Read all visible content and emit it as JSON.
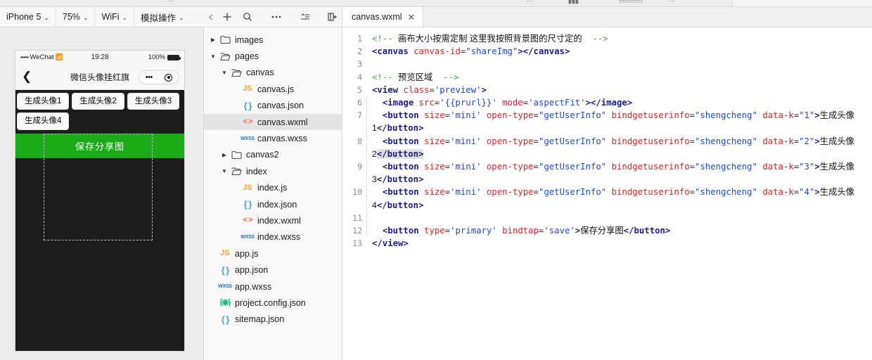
{
  "top_bar": {
    "ghosts": [
      "···",
      "···",
      "▮▮▮",
      "▭▭▭▭",
      "···"
    ]
  },
  "simulator": {
    "toolbar": [
      {
        "label": "iPhone 5",
        "caret": "⌄",
        "name": "device-selector"
      },
      {
        "label": "75%",
        "caret": "⌄",
        "name": "zoom-selector"
      },
      {
        "label": "WiFi",
        "caret": "⌄",
        "name": "network-selector"
      },
      {
        "label": "模拟操作",
        "caret": "⌄",
        "name": "simulate-action-selector"
      }
    ],
    "phone": {
      "status": {
        "signal_dots": "•••••",
        "carrier": "WeChat",
        "wifi_icon": "wifi-icon",
        "time": "19:28",
        "battery_percent": "100%"
      },
      "nav": {
        "back_icon": "back-chevron-icon",
        "title": "微信头像挂红旗",
        "capsule_dots": "•••",
        "capsule_target": "target-icon"
      },
      "mini_buttons": [
        "生成头像1",
        "生成头像2",
        "生成头像3",
        "生成头像4"
      ],
      "primary_button": "保存分享图",
      "canvas_placeholder": "canvas-placeholder"
    }
  },
  "explorer": {
    "toolbar_icons": [
      {
        "name": "back-arrow-icon",
        "glyph": "⤶"
      },
      {
        "name": "add-icon",
        "glyph": "+"
      },
      {
        "name": "search-icon",
        "glyph": "search"
      },
      {
        "name": "more-icon",
        "glyph": "•••"
      },
      {
        "name": "collapse-all-icon",
        "glyph": "collapse"
      },
      {
        "name": "toggle-panel-icon",
        "glyph": "panel"
      }
    ],
    "tree": [
      {
        "label": "images",
        "indent": 0,
        "twisty": "▶",
        "icon": "folder-closed",
        "selected": false
      },
      {
        "label": "pages",
        "indent": 0,
        "twisty": "▼",
        "icon": "folder-open",
        "selected": false
      },
      {
        "label": "canvas",
        "indent": 1,
        "twisty": "▼",
        "icon": "folder-open",
        "selected": false
      },
      {
        "label": "canvas.js",
        "indent": 2,
        "twisty": "",
        "icon": "js",
        "selected": false
      },
      {
        "label": "canvas.json",
        "indent": 2,
        "twisty": "",
        "icon": "json",
        "selected": false
      },
      {
        "label": "canvas.wxml",
        "indent": 2,
        "twisty": "",
        "icon": "wxml",
        "selected": true
      },
      {
        "label": "canvas.wxss",
        "indent": 2,
        "twisty": "",
        "icon": "wxss",
        "selected": false
      },
      {
        "label": "canvas2",
        "indent": 1,
        "twisty": "▶",
        "icon": "folder-closed",
        "selected": false
      },
      {
        "label": "index",
        "indent": 1,
        "twisty": "▼",
        "icon": "folder-open",
        "selected": false
      },
      {
        "label": "index.js",
        "indent": 2,
        "twisty": "",
        "icon": "js",
        "selected": false
      },
      {
        "label": "index.json",
        "indent": 2,
        "twisty": "",
        "icon": "json",
        "selected": false
      },
      {
        "label": "index.wxml",
        "indent": 2,
        "twisty": "",
        "icon": "wxml",
        "selected": false
      },
      {
        "label": "index.wxss",
        "indent": 2,
        "twisty": "",
        "icon": "wxss",
        "selected": false
      },
      {
        "label": "app.js",
        "indent": 0,
        "twisty": "",
        "icon": "js",
        "selected": false
      },
      {
        "label": "app.json",
        "indent": 0,
        "twisty": "",
        "icon": "json",
        "selected": false
      },
      {
        "label": "app.wxss",
        "indent": 0,
        "twisty": "",
        "icon": "wxss",
        "selected": false
      },
      {
        "label": "project.config.json",
        "indent": 0,
        "twisty": "",
        "icon": "cfg",
        "selected": false
      },
      {
        "label": "sitemap.json",
        "indent": 0,
        "twisty": "",
        "icon": "json",
        "selected": false
      }
    ]
  },
  "editor": {
    "tab": {
      "label": "canvas.wxml",
      "close": "✕"
    },
    "lines": [
      {
        "n": "1",
        "guide": false
      },
      {
        "n": "2",
        "guide": false
      },
      {
        "n": "3",
        "guide": false
      },
      {
        "n": "4",
        "guide": false
      },
      {
        "n": "5",
        "guide": false
      },
      {
        "n": "6",
        "guide": true
      },
      {
        "n": "7",
        "guide": true
      },
      {
        "n": "8",
        "guide": true
      },
      {
        "n": "9",
        "guide": true
      },
      {
        "n": "10",
        "guide": true
      },
      {
        "n": "11",
        "guide": true
      },
      {
        "n": "12",
        "guide": true
      },
      {
        "n": "13",
        "guide": false
      }
    ],
    "code_text": {
      "l1": "<!-- 画布大小按需定制 这里我按照背景图的尺寸定的  -->",
      "l2": "<canvas canvas-id=\"shareImg\"></canvas>",
      "l4": "<!-- 预览区域  -->",
      "l5": "<view class='preview'>",
      "l6": "<image src='{{prurl}}' mode='aspectFit'></image>",
      "l7": "<button size='mini' open-type=\"getUserInfo\" bindgetuserinfo=\"shengcheng\" data-k=\"1\">生成头像1</button>",
      "l8": "<button size='mini' open-type=\"getUserInfo\" bindgetuserinfo=\"shengcheng\" data-k=\"2\">生成头像2</button>",
      "l9": "<button size='mini' open-type=\"getUserInfo\" bindgetuserinfo=\"shengcheng\" data-k=\"3\">生成头像3</button>",
      "l10": "<button size='mini' open-type=\"getUserInfo\" bindgetuserinfo=\"shengcheng\" data-k=\"4\">生成头像4</button>",
      "l12": "<button type='primary' bindtap='save'>保存分享图</button>",
      "l13": "</view>"
    }
  },
  "colors": {
    "accent_green": "#1aad19",
    "comment": "#4a9a4a",
    "tag": "#1b1b8f",
    "attribute": "#e02020",
    "value": "#1a49d6",
    "selection": "#e0e0e0"
  }
}
